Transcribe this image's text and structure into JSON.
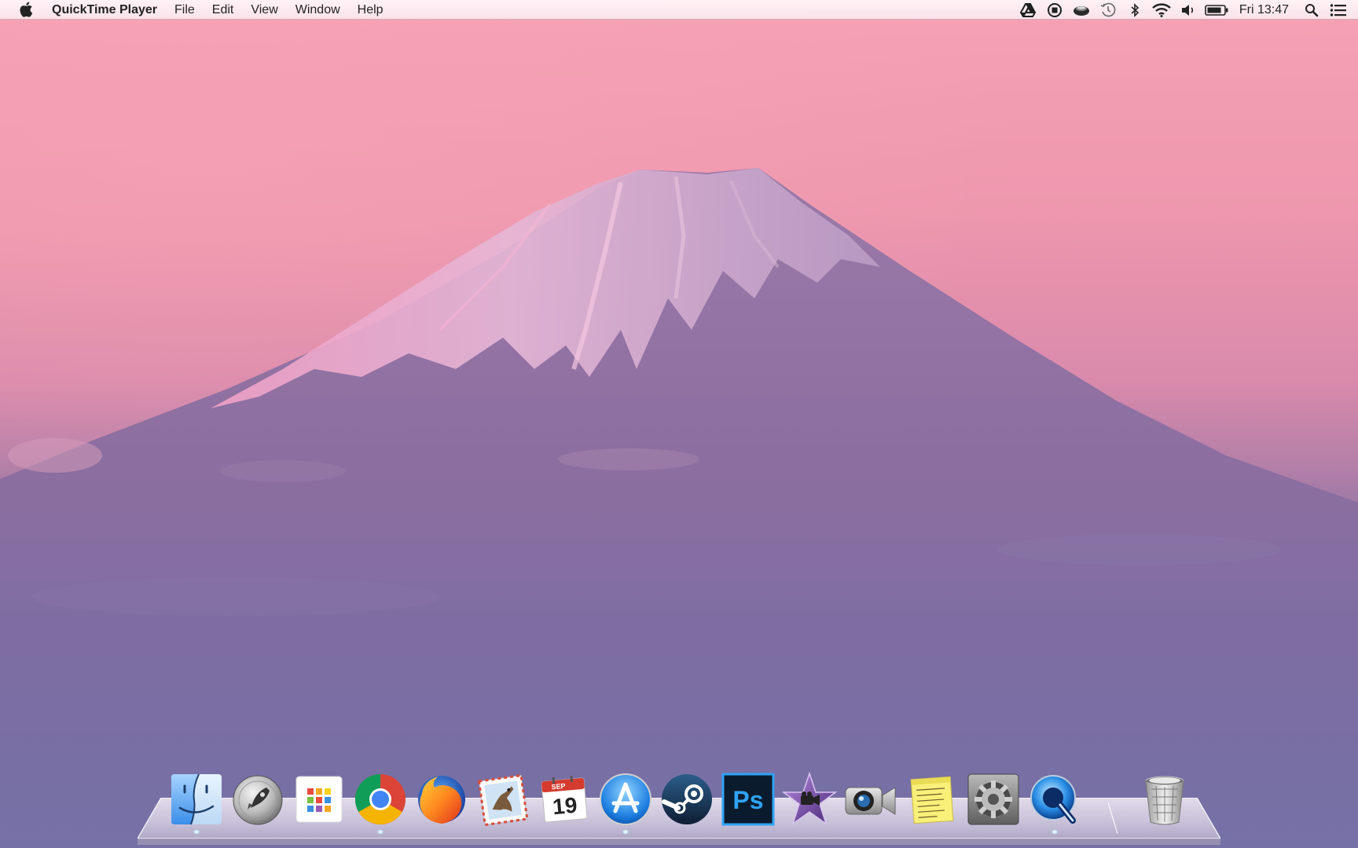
{
  "menubar": {
    "apple_icon": "apple-icon",
    "app_name": "QuickTime Player",
    "menus": [
      "File",
      "Edit",
      "View",
      "Window",
      "Help"
    ],
    "status_icons": [
      "google-drive-icon",
      "record-icon",
      "cloud-app-icon",
      "time-machine-icon",
      "bluetooth-icon",
      "wifi-icon",
      "volume-icon",
      "battery-icon"
    ],
    "clock": "Fri 13:47",
    "spotlight_icon": "search-icon",
    "notification_icon": "list-icon"
  },
  "dock": {
    "apps": [
      {
        "name": "Finder",
        "icon": "finder-icon",
        "running": true
      },
      {
        "name": "Launchpad",
        "icon": "launchpad-icon",
        "running": false
      },
      {
        "name": "App Grid",
        "icon": "app-grid-icon",
        "running": false
      },
      {
        "name": "Google Chrome",
        "icon": "chrome-icon",
        "running": true
      },
      {
        "name": "Firefox",
        "icon": "firefox-icon",
        "running": false
      },
      {
        "name": "Mail",
        "icon": "mail-icon",
        "running": false
      },
      {
        "name": "Calendar",
        "icon": "calendar-icon",
        "running": false,
        "month": "SEP",
        "day": "19"
      },
      {
        "name": "App Store",
        "icon": "app-store-icon",
        "running": true
      },
      {
        "name": "Steam",
        "icon": "steam-icon",
        "running": false
      },
      {
        "name": "Photoshop",
        "icon": "photoshop-icon",
        "running": false,
        "label": "Ps"
      },
      {
        "name": "iMovie",
        "icon": "imovie-icon",
        "running": false
      },
      {
        "name": "FaceTime",
        "icon": "facetime-icon",
        "running": false
      },
      {
        "name": "Stickies",
        "icon": "stickies-icon",
        "running": false
      },
      {
        "name": "System Preferences",
        "icon": "system-preferences-icon",
        "running": false
      },
      {
        "name": "QuickTime Player",
        "icon": "quicktime-icon",
        "running": true
      },
      {
        "name": "Trash",
        "icon": "trash-icon",
        "running": false
      }
    ]
  },
  "colors": {
    "sky_top": "#f49bb0",
    "mountain": "#8a6d9e",
    "snow": "#e9c6dc",
    "menubar": "#fbeef2"
  }
}
